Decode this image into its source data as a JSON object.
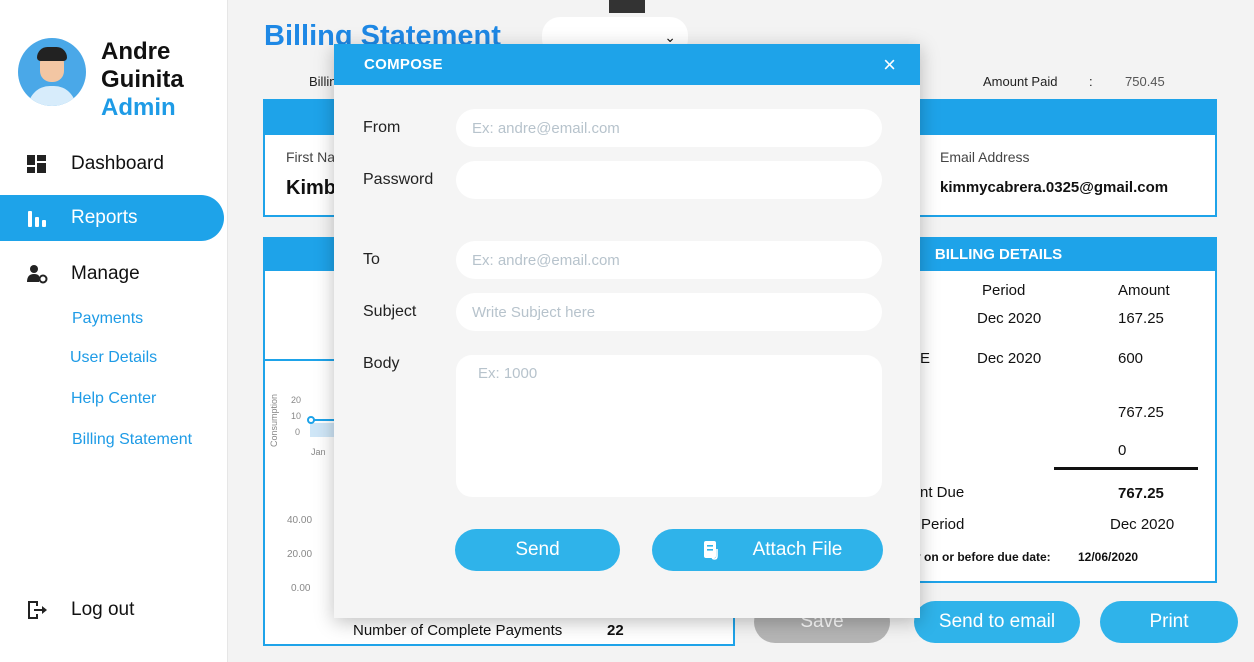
{
  "user": {
    "first_name": "Andre",
    "last_name": "Guinita",
    "role": "Admin"
  },
  "nav": {
    "dashboard": "Dashboard",
    "reports": "Reports",
    "manage": "Manage",
    "sub": [
      "Payments",
      "User Details",
      "Help Center",
      "Billing Statement"
    ],
    "logout": "Log out"
  },
  "page": {
    "title": "Billing Statement",
    "billin_label": "Billin",
    "amount_paid_label": "Amount Paid",
    "amount_paid_colon": ":",
    "amount_paid_value": "750.45"
  },
  "customer": {
    "first_name_label": "First Na",
    "first_name_value": "Kimb",
    "email_label": "Email Address",
    "email_value": "kimmycabrera.0325@gmail.com"
  },
  "chart": {
    "ylabel": "Consumption",
    "yticks": [
      "20",
      "10",
      "0"
    ],
    "xtick": "Jan",
    "y2ticks": [
      "40.00",
      "20.00",
      "0.00"
    ]
  },
  "billing": {
    "header": "BILLING DETAILS",
    "col_period": "Period",
    "col_amount": "Amount",
    "row1_period": "Dec 2020",
    "row1_amount": "167.25",
    "row2_prefix": "E",
    "row2_period": "Dec 2020",
    "row2_amount": "600",
    "subtotal": "767.25",
    "zero": "0",
    "amount_due_label": "nt Due",
    "amount_due_value": "767.25",
    "period_label": "Period",
    "period_value": "Dec 2020",
    "due_note": "y on or before due date:",
    "due_date": "12/06/2020"
  },
  "payments": {
    "label": "Number of Complete Payments",
    "value": "22"
  },
  "buttons": {
    "save": "Save",
    "send_email": "Send to email",
    "print": "Print"
  },
  "compose": {
    "title": "COMPOSE",
    "close": "×",
    "from_label": "From",
    "from_placeholder": "Ex: andre@email.com",
    "password_label": "Password",
    "to_label": "To",
    "to_placeholder": "Ex: andre@email.com",
    "subject_label": "Subject",
    "subject_placeholder": "Write Subject here",
    "body_label": "Body",
    "body_placeholder": "Ex: 1000",
    "send": "Send",
    "attach": "Attach File"
  },
  "colors": {
    "accent": "#1ea3e9",
    "title_blue": "#1e88e5",
    "button_blue": "#2fb3ea",
    "disabled": "#b5b5b5"
  }
}
